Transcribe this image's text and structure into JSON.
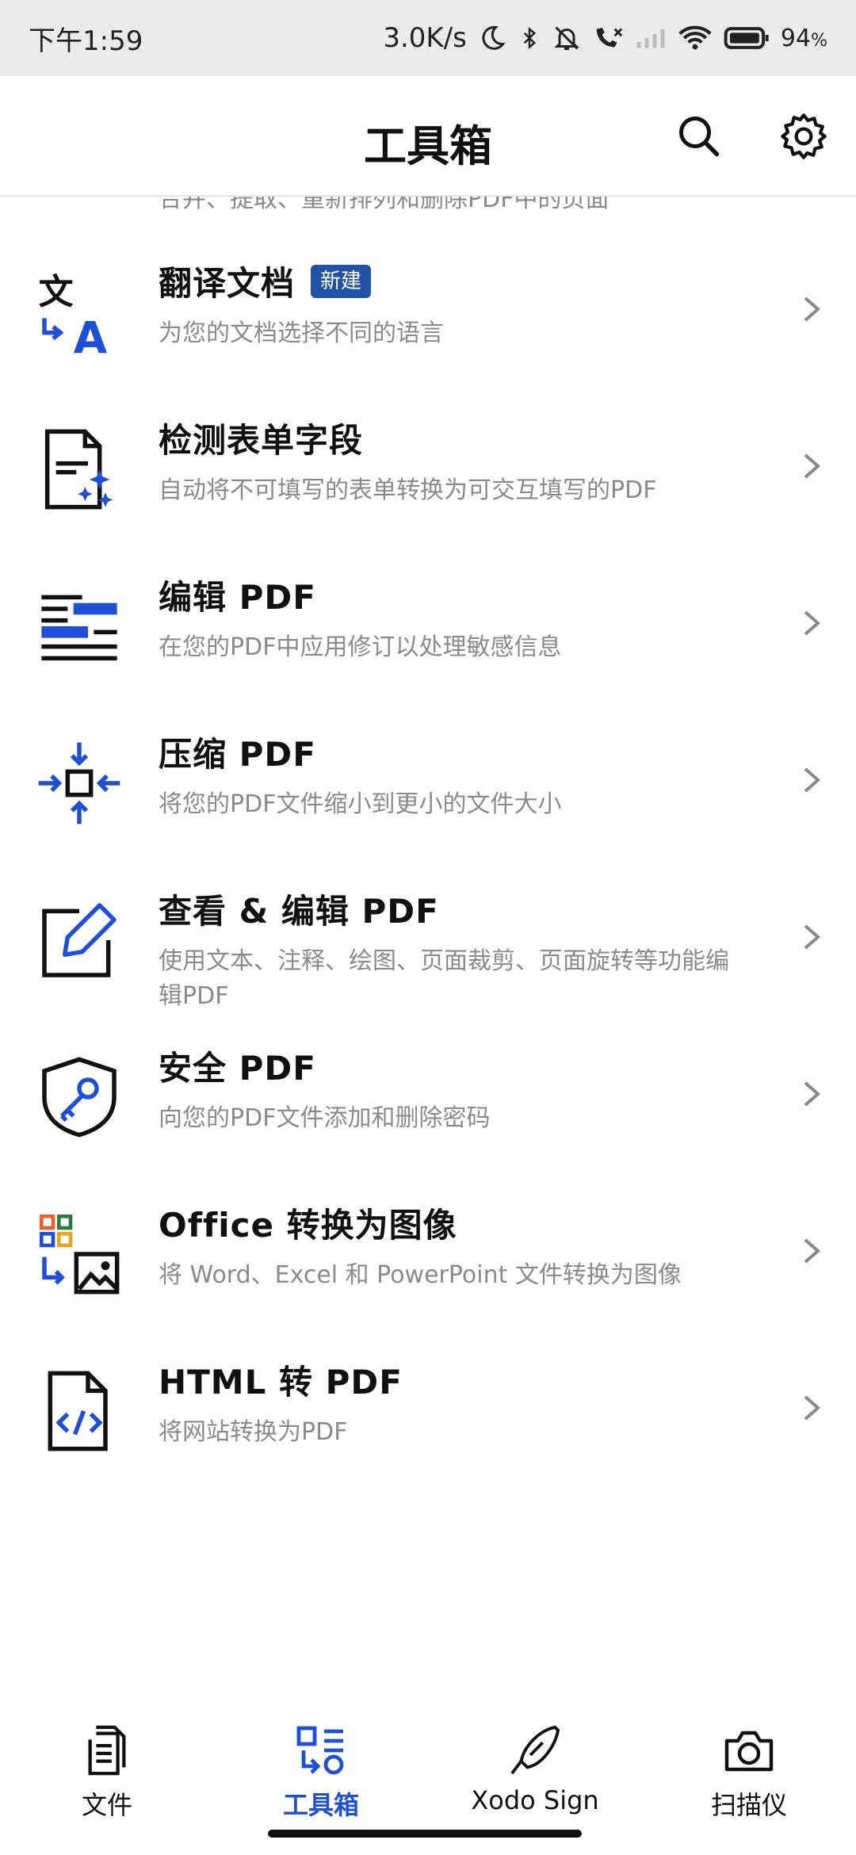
{
  "status_bar": {
    "time": "下午1:59",
    "network_speed": "3.0K/s",
    "battery_percent": "94",
    "battery_unit": "%"
  },
  "app_bar": {
    "title": "工具箱",
    "search_icon": "search-icon",
    "settings_icon": "gear-icon"
  },
  "partial_item": {
    "desc": "合并、提取、重新排列和删除PDF中的页面"
  },
  "tools": [
    {
      "title": "翻译文档",
      "badge": "新建",
      "desc": "为您的文档选择不同的语言",
      "icon": "translate-icon"
    },
    {
      "title": "检测表单字段",
      "badge": "",
      "desc": "自动将不可填写的表单转换为可交互填写的PDF",
      "icon": "form-detect-icon"
    },
    {
      "title": "编辑 PDF",
      "badge": "",
      "desc": "在您的PDF中应用修订以处理敏感信息",
      "icon": "redact-icon"
    },
    {
      "title": "压缩 PDF",
      "badge": "",
      "desc": "将您的PDF文件缩小到更小的文件大小",
      "icon": "compress-icon"
    },
    {
      "title": "查看 & 编辑 PDF",
      "badge": "",
      "desc": "使用文本、注释、绘图、页面裁剪、页面旋转等功能编辑PDF",
      "icon": "edit-icon"
    },
    {
      "title": "安全 PDF",
      "badge": "",
      "desc": "向您的PDF文件添加和删除密码",
      "icon": "secure-shield-icon"
    },
    {
      "title": "Office 转换为图像",
      "badge": "",
      "desc": "将 Word、Excel 和 PowerPoint 文件转换为图像",
      "icon": "office-to-image-icon"
    },
    {
      "title": "HTML 转 PDF",
      "badge": "",
      "desc": "将网站转换为PDF",
      "icon": "html-file-icon"
    }
  ],
  "bottom_nav": [
    {
      "label": "文件",
      "icon": "document-icon",
      "active": false
    },
    {
      "label": "工具箱",
      "icon": "toolbox-icon",
      "active": true
    },
    {
      "label": "Xodo Sign",
      "icon": "pen-nib-icon",
      "active": false
    },
    {
      "label": "扫描仪",
      "icon": "camera-icon",
      "active": false
    }
  ],
  "colors": {
    "accent": "#1f4fd6",
    "badge": "#2252a5",
    "secondary_text": "#8a8a8a"
  }
}
